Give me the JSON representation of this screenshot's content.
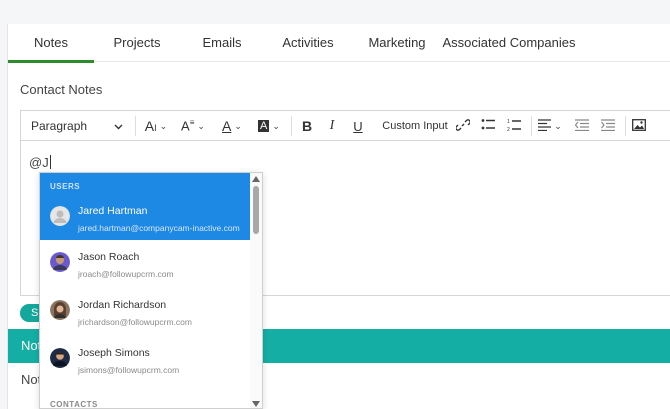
{
  "tabs": [
    {
      "label": "Notes",
      "active": true
    },
    {
      "label": "Projects"
    },
    {
      "label": "Emails"
    },
    {
      "label": "Activities"
    },
    {
      "label": "Marketing"
    },
    {
      "label": "Associated Companies"
    }
  ],
  "section_title": "Contact Notes",
  "toolbar": {
    "paragraph": "Paragraph",
    "custom_input": "Custom Input"
  },
  "editor_text": "@J",
  "save_label": "S",
  "band_label": "Not",
  "row_label": "Not",
  "dropdown": {
    "users_header": "USERS",
    "contacts_header": "CONTACTS",
    "users": [
      {
        "name": "Jared Hartman",
        "email": "jared.hartman@companycam-inactive.com",
        "selected": true
      },
      {
        "name": "Jason Roach",
        "email": "jroach@followupcrm.com"
      },
      {
        "name": "Jordan Richardson",
        "email": "jrichardson@followupcrm.com"
      },
      {
        "name": "Joseph Simons",
        "email": "jsimons@followupcrm.com"
      }
    ]
  },
  "colors": {
    "accent": "#2e8b2e",
    "teal": "#14aea5",
    "selected": "#1e88e5"
  }
}
